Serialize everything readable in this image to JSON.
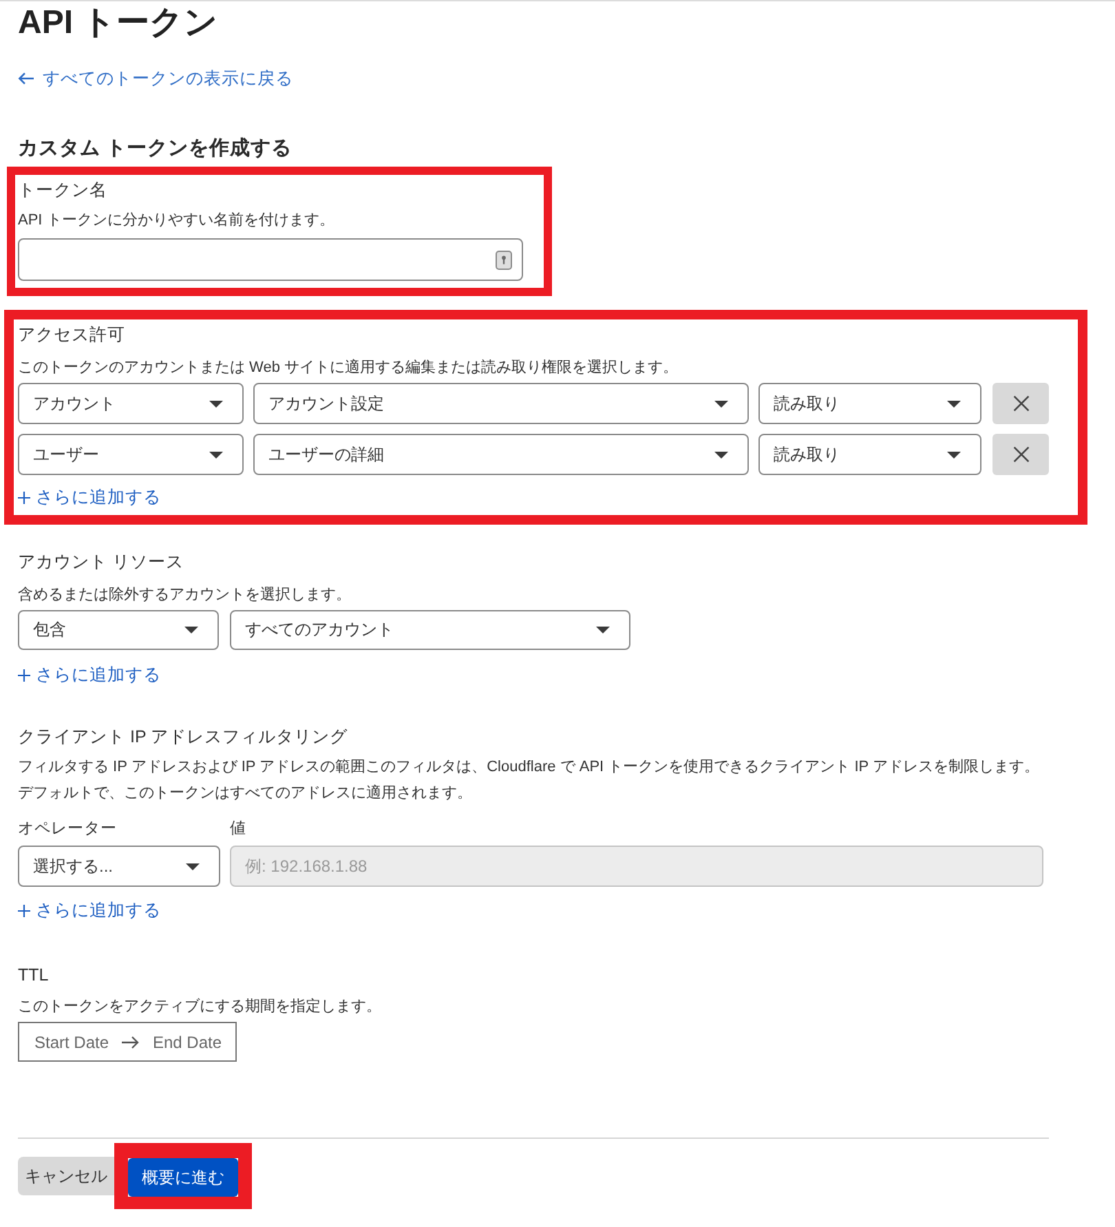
{
  "page": {
    "title": "API トークン",
    "back_link": "すべてのトークンの表示に戻る",
    "heading": "カスタム トークンを作成する"
  },
  "token_name": {
    "highlighted": true,
    "label": "トークン名",
    "description": "API トークンに分かりやすい名前を付けます。"
  },
  "permissions": {
    "highlighted": true,
    "label": "アクセス許可",
    "description": "このトークンのアカウントまたは Web サイトに適用する編集または読み取り権限を選択します。",
    "rows": [
      {
        "resource": "アカウント",
        "item": "アカウント設定",
        "access": "読み取り"
      },
      {
        "resource": "ユーザー",
        "item": "ユーザーの詳細",
        "access": "読み取り"
      }
    ],
    "add_more": "さらに追加する"
  },
  "account_resources": {
    "label": "アカウント リソース",
    "description": "含めるまたは除外するアカウントを選択します。",
    "mode": "包含",
    "scope": "すべてのアカウント",
    "add_more": "さらに追加する"
  },
  "ip_filtering": {
    "label": "クライアント IP アドレスフィルタリング",
    "description": "フィルタする IP アドレスおよび IP アドレスの範囲このフィルタは、Cloudflare で API トークンを使用できるクライアント IP アドレスを制限します。デフォルトで、このトークンはすべてのアドレスに適用されます。",
    "operator_label": "オペレーター",
    "value_label": "値",
    "operator": "選択する...",
    "value": {
      "placeholder": "例: 192.168.1.88",
      "disabled": true
    },
    "add_more": "さらに追加する"
  },
  "ttl": {
    "label": "TTL",
    "description": "このトークンをアクティブにする期間を指定します。",
    "start": {
      "placeholder": "Start Date"
    },
    "end": {
      "placeholder": "End Date"
    }
  },
  "actions": [
    {
      "label": "キャンセル",
      "kind": "secondary",
      "highlighted": false
    },
    {
      "label": "概要に進む",
      "kind": "primary",
      "highlighted": true
    }
  ]
}
